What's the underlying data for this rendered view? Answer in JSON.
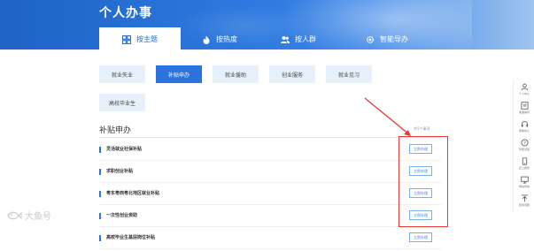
{
  "page": {
    "title": "个人办事"
  },
  "tabs": [
    {
      "label": "按主题",
      "icon": "grid-icon",
      "active": true
    },
    {
      "label": "按热度",
      "icon": "flame-icon",
      "active": false
    },
    {
      "label": "按人群",
      "icon": "people-icon",
      "active": false
    },
    {
      "label": "智能导办",
      "icon": "settings-icon",
      "active": false
    }
  ],
  "categories": [
    {
      "label": "就业失业",
      "active": false
    },
    {
      "label": "补贴申办",
      "active": true
    },
    {
      "label": "就业援助",
      "active": false
    },
    {
      "label": "创业服务",
      "active": false
    },
    {
      "label": "就业见习",
      "active": false
    },
    {
      "label": "高校毕业生",
      "active": false
    }
  ],
  "section": {
    "title": "补贴申办",
    "count": "共5个事项"
  },
  "items": [
    {
      "name": "灵活就业社保补贴",
      "action": "立即办理"
    },
    {
      "name": "求职创业补贴",
      "action": "立即办理"
    },
    {
      "name": "粤东粤西粤北地区就业补贴",
      "action": "立即办理"
    },
    {
      "name": "一次性创业资助",
      "action": "立即办理"
    },
    {
      "name": "高校毕业生基层岗位补贴",
      "action": "立即办理"
    }
  ],
  "sidebar": [
    {
      "label": "个人中心",
      "icon": "user-icon"
    },
    {
      "label": "收藏事项",
      "icon": "list-icon"
    },
    {
      "label": "帮助中心",
      "icon": "headset-icon"
    },
    {
      "label": "智能问答",
      "icon": "robot-icon"
    },
    {
      "label": "掌上服务",
      "icon": "phone-icon"
    },
    {
      "label": "网站导航",
      "icon": "monitor-icon"
    },
    {
      "label": "回到顶部",
      "icon": "arrow-up-icon"
    }
  ],
  "watermark": {
    "text": "大鱼号"
  },
  "colors": {
    "primary": "#2a73dc",
    "highlight": "#e53935",
    "category_bg": "#e6f0fb"
  }
}
